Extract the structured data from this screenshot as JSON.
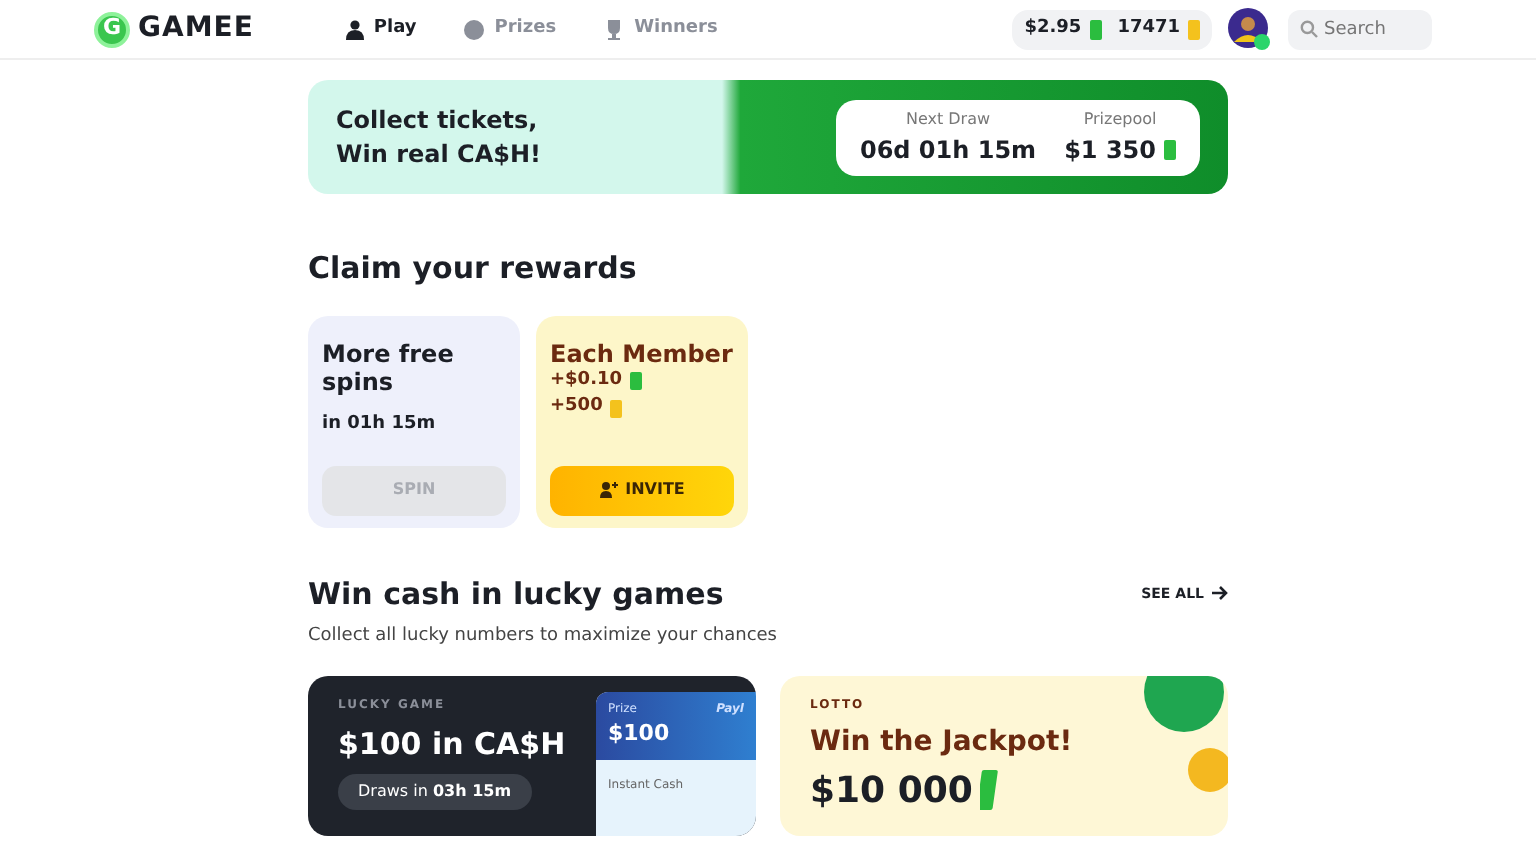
{
  "header": {
    "logo_letter": "G",
    "logo_text": "GAMEE",
    "nav": [
      {
        "label": "Play",
        "selected": true
      },
      {
        "label": "Prizes",
        "selected": false
      },
      {
        "label": "Winners",
        "selected": false
      }
    ],
    "cash": "$2.95",
    "tickets": "17471",
    "search": {
      "placeholder": "Search"
    }
  },
  "banner": {
    "title": "Collect tickets,\nWin real CA$H!",
    "next_draw_label": "Next Draw",
    "next_draw": "06d 01h 15m",
    "prizepool_label": "Prizepool",
    "prizepool": "$1 350"
  },
  "rewards": {
    "title": "Claim your rewards",
    "cards": [
      {
        "kind": "spin",
        "title": "More free spins",
        "subtitle": "in 01h 15m",
        "button": "SPIN",
        "disabled": true
      },
      {
        "kind": "invite",
        "title": "Each Member",
        "lines": [
          "+$0.10",
          "+500"
        ],
        "button": "INVITE",
        "disabled": false
      }
    ]
  },
  "lucky": {
    "title": "Win cash in lucky games",
    "see_all": "SEE ALL",
    "subtitle": "Collect all lucky numbers to maximize your chances",
    "games": [
      {
        "kind": "lucky",
        "tag": "LUCKY GAME",
        "title": "$100 in CA$H",
        "draws": "Draws in **03h 15m**",
        "prize_label": "Prize",
        "prize": "$100",
        "brand": "Payl",
        "prize_type": "Instant Cash"
      },
      {
        "kind": "lotto",
        "tag": "LOTTO",
        "title": "Win the Jackpot!",
        "amount": "$10 000"
      }
    ]
  }
}
